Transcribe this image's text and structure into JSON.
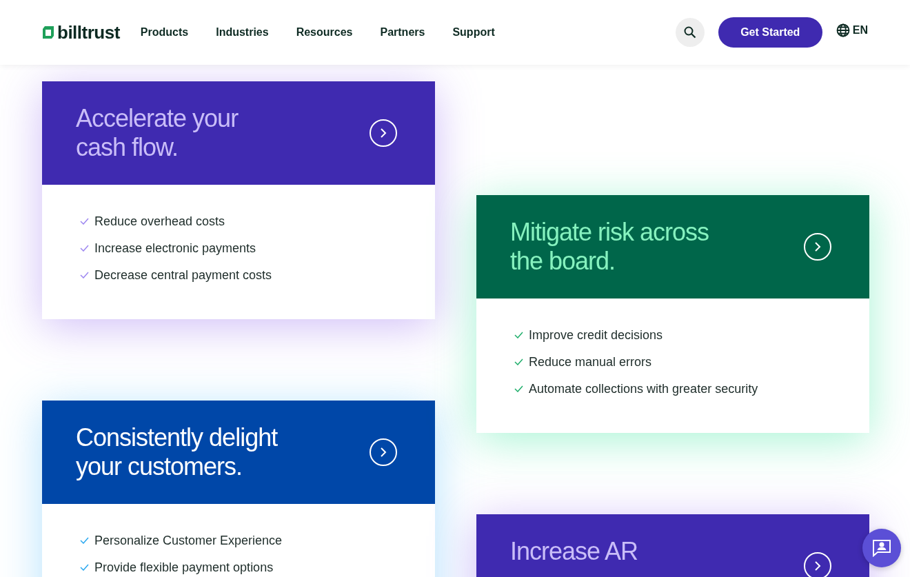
{
  "header": {
    "logo": "billtrust",
    "nav": [
      "Products",
      "Industries",
      "Resources",
      "Partners",
      "Support"
    ],
    "cta": "Get Started",
    "language": "EN"
  },
  "cards": [
    {
      "title": "Accelerate your cash flow.",
      "color": "#3f2ab0",
      "items": [
        "Reduce overhead costs",
        "Increase electronic payments",
        "Decrease central payment costs"
      ]
    },
    {
      "title": "Mitigate risk across the board.",
      "color": "#00664a",
      "items": [
        "Improve credit decisions",
        "Reduce manual errors",
        "Automate collections with greater security"
      ]
    },
    {
      "title": "Consistently delight your customers.",
      "color": "#0047a8",
      "items": [
        "Personalize Customer Experience",
        "Provide flexible payment options"
      ]
    },
    {
      "title": "Increase AR",
      "color": "#3f2ab0"
    }
  ]
}
